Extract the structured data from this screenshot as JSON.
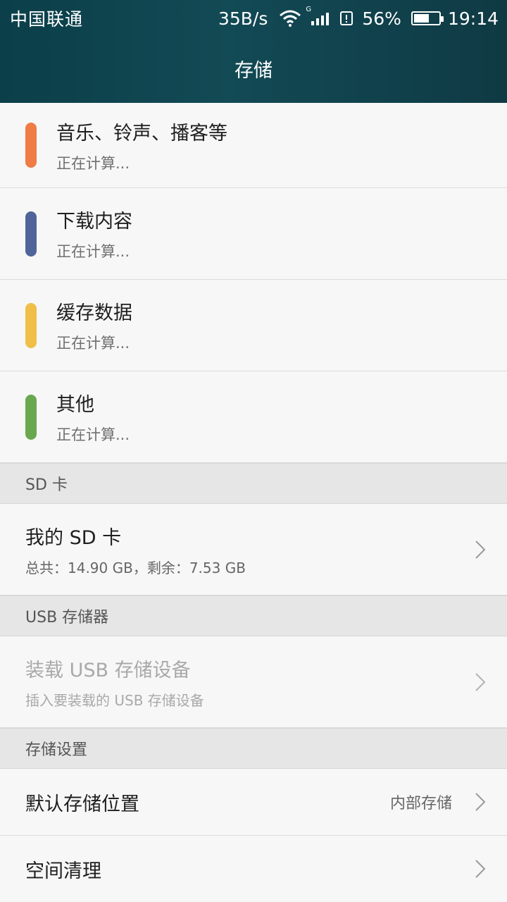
{
  "status": {
    "carrier": "中国联通",
    "speed": "35B/s",
    "network_label": "G",
    "battery": "56%",
    "time": "19:14"
  },
  "header": {
    "title": "存储"
  },
  "categories": [
    {
      "title": "音乐、铃声、播客等",
      "subtitle": "正在计算...",
      "color": "#ef7b45"
    },
    {
      "title": "下载内容",
      "subtitle": "正在计算...",
      "color": "#4f659a"
    },
    {
      "title": "缓存数据",
      "subtitle": "正在计算...",
      "color": "#f0bf48"
    },
    {
      "title": "其他",
      "subtitle": "正在计算...",
      "color": "#6aa84f"
    }
  ],
  "sections": {
    "sd": {
      "label": "SD 卡",
      "item": {
        "title": "我的 SD 卡",
        "subtitle": "总共：14.90 GB，剩余：7.53 GB"
      }
    },
    "usb": {
      "label": "USB 存储器",
      "item": {
        "title": "装载 USB 存储设备",
        "subtitle": "插入要装载的 USB 存储设备"
      }
    },
    "settings": {
      "label": "存储设置",
      "items": [
        {
          "title": "默认存储位置",
          "value": "内部存储"
        },
        {
          "title": "空间清理",
          "value": ""
        }
      ]
    }
  }
}
